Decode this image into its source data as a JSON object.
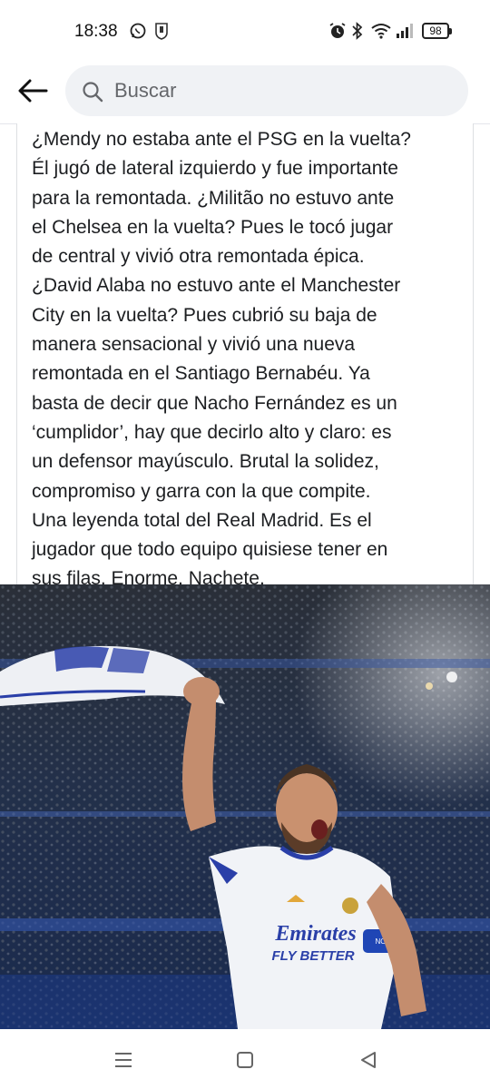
{
  "status_bar": {
    "time": "18:38",
    "battery": "98",
    "icons": [
      "whatsapp-icon",
      "app-notification-icon",
      "alarm-icon",
      "bluetooth-icon",
      "wifi-icon",
      "signal-icon",
      "battery-icon"
    ]
  },
  "search": {
    "placeholder": "Buscar"
  },
  "post": {
    "text": "¿Mendy no estaba ante el PSG en la vuelta?\nÉl jugó de lateral izquierdo y fue importante\npara la remontada. ¿Militão no estuvo ante\nel Chelsea en la vuelta? Pues le tocó jugar\nde central y vivió otra remontada épica.\n¿David Alaba no estuvo ante el Manchester\nCity en la vuelta? Pues cubrió su baja de\nmanera sensacional y vivió una nueva\nremontada en el Santiago Bernabéu. Ya\nbasta de decir que Nacho Fernández es un\n‘cumplidor’, hay que decirlo alto y claro: es\nun defensor mayúsculo. Brutal la solidez,\ncompromiso y garra con la que compite.\nUna leyenda total del Real Madrid. Es el\njugador que todo equipo quisiese tener en\nsus filas. Enorme, Nachete.",
    "photo": {
      "shirt_sponsor_line1": "Emirates",
      "shirt_sponsor_line2": "FLY BETTER",
      "armband_text": "NO TO"
    }
  },
  "nav_bar": {
    "items": [
      "menu-icon",
      "home-icon",
      "back-icon"
    ]
  },
  "colors": {
    "search_bg": "#f0f2f5",
    "text": "#1c1e21",
    "placeholder": "#65676b",
    "shirt": "#f1f3f7",
    "shirt_trim": "#2a3fa8"
  }
}
